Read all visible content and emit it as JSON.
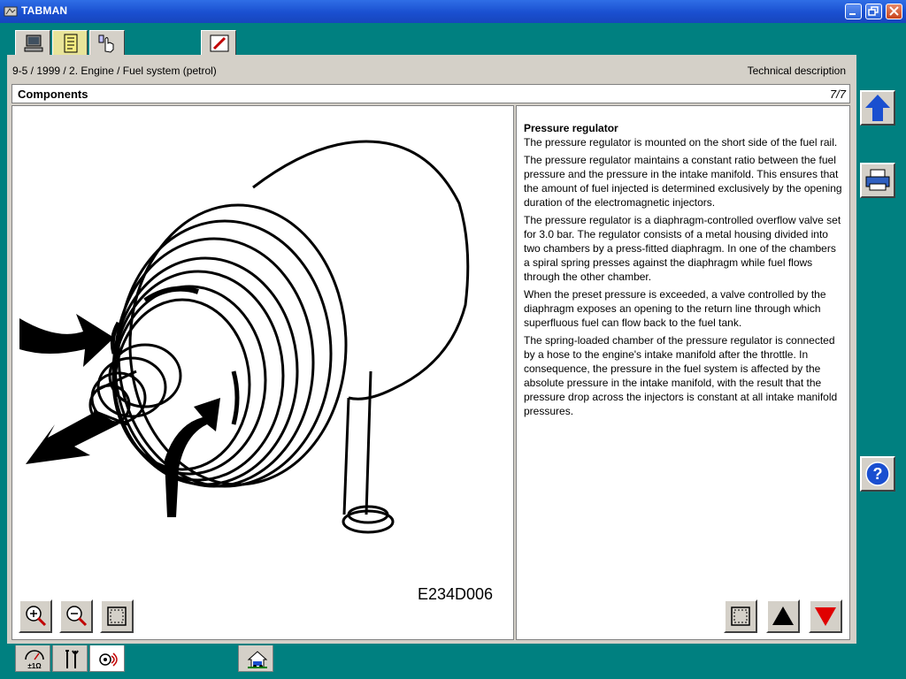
{
  "window": {
    "title": "TABMAN"
  },
  "header": {
    "breadcrumb": "9-5 / 1999 / 2. Engine / Fuel system (petrol)",
    "doc_type": "Technical description",
    "section": "Components",
    "page": "7/7"
  },
  "figure": {
    "id": "E234D006"
  },
  "text": {
    "heading": "Pressure regulator",
    "paragraphs": [
      "The pressure regulator is mounted on the short side of the fuel rail.",
      "The pressure regulator maintains a constant ratio between the fuel pressure and the pressure in the intake manifold. This ensures that the amount of fuel injected is determined exclusively by the opening duration of the electromagnetic injectors.",
      "The pressure regulator is a diaphragm-controlled overflow valve set for 3.0 bar. The regulator consists of a metal housing divided into two chambers by a press-fitted diaphragm. In one of the chambers a spiral spring presses against the diaphragm while fuel flows through the other chamber.",
      "When the preset pressure is exceeded, a valve controlled by the diaphragm exposes an opening to the return line through which superfluous fuel can flow back to the fuel tank.",
      "The spring-loaded chamber of the pressure regulator is connected by a hose to the engine's intake manifold after the throttle. In consequence, the pressure in the fuel system is affected by the absolute pressure in the intake manifold, with the result that the pressure drop across the injectors is constant at all intake manifold pressures."
    ]
  },
  "top_tabs": [
    {
      "icon": "computer-icon"
    },
    {
      "icon": "notebook-icon"
    },
    {
      "icon": "hand-pointer-icon"
    },
    {
      "icon": "pencil-icon"
    }
  ],
  "bottom_tabs": [
    {
      "icon": "meter-icon",
      "label": "±1Ω"
    },
    {
      "icon": "wrench-icon"
    },
    {
      "icon": "component-icon",
      "active": true
    },
    {
      "icon": "home-car-icon"
    }
  ],
  "colors": {
    "desktop": "#008080",
    "panel": "#d4d0c8",
    "accent_blue": "#1a4fd0",
    "arrow_red": "#e00000"
  }
}
